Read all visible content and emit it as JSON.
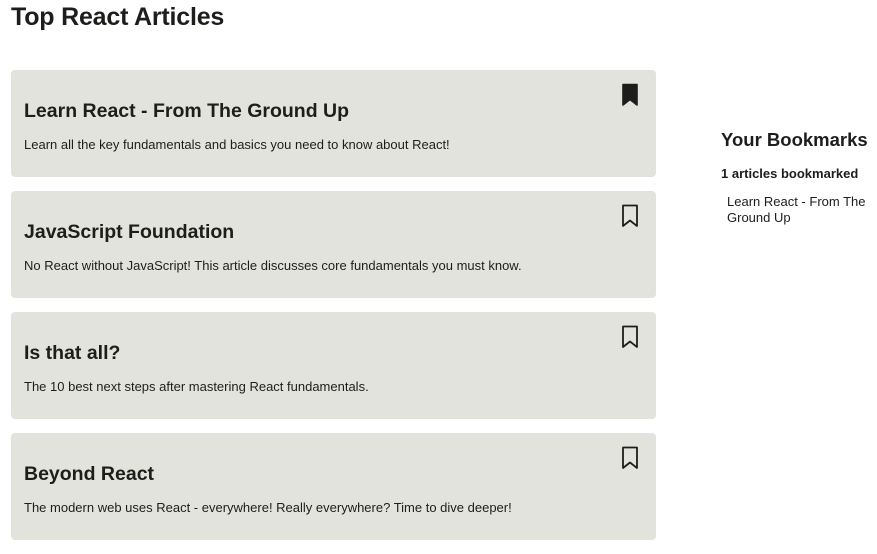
{
  "page": {
    "title": "Top React Articles"
  },
  "articles": [
    {
      "title": "Learn React - From The Ground Up",
      "description": "Learn all the key fundamentals and basics you need to know about React!",
      "bookmarked": true,
      "icon": "bookmark-filled-icon"
    },
    {
      "title": "JavaScript Foundation",
      "description": "No React without JavaScript! This article discusses core fundamentals you must know.",
      "bookmarked": false,
      "icon": "bookmark-outline-icon"
    },
    {
      "title": "Is that all?",
      "description": "The 10 best next steps after mastering React fundamentals.",
      "bookmarked": false,
      "icon": "bookmark-outline-icon"
    },
    {
      "title": "Beyond React",
      "description": "The modern web uses React - everywhere! Really everywhere? Time to dive deeper!",
      "bookmarked": false,
      "icon": "bookmark-outline-icon"
    }
  ],
  "sidebar": {
    "title": "Your Bookmarks",
    "count_text": "1 articles bookmarked",
    "items": [
      "Learn React - From The Ground Up"
    ]
  },
  "colors": {
    "card_background": "#e3e3de",
    "text": "#1d1d1b",
    "page_background": "#ffffff"
  }
}
